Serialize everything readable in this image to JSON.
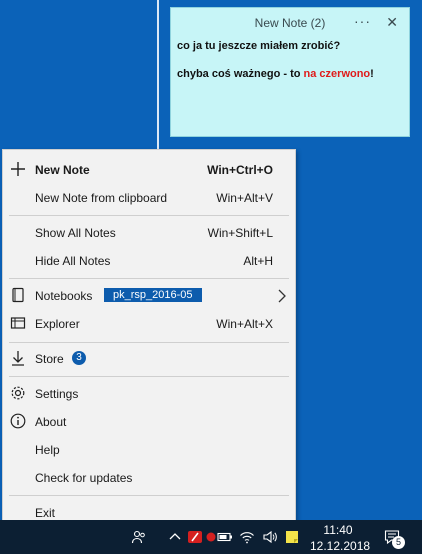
{
  "note": {
    "title": "New Note (2)",
    "more_glyph": "···",
    "close_glyph": "✕",
    "line1": "co ja tu jeszcze miałem zrobić?",
    "line2_prefix": "chyba coś ważnego - to ",
    "line2_red": "na czerwono",
    "line2_suffix": "!"
  },
  "menu": {
    "new_note": {
      "label": "New Note",
      "shortcut": "Win+Ctrl+O"
    },
    "new_from_clipboard": {
      "label": "New Note from clipboard",
      "shortcut": "Win+Alt+V"
    },
    "show_all": {
      "label": "Show All Notes",
      "shortcut": "Win+Shift+L"
    },
    "hide_all": {
      "label": "Hide All Notes",
      "shortcut": "Alt+H"
    },
    "notebooks": {
      "label": "Notebooks",
      "current": "pk_rsp_2016-05"
    },
    "explorer": {
      "label": "Explorer",
      "shortcut": "Win+Alt+X"
    },
    "store": {
      "label": "Store",
      "badge": "3"
    },
    "settings": {
      "label": "Settings"
    },
    "about": {
      "label": "About"
    },
    "help": {
      "label": "Help"
    },
    "check_updates": {
      "label": "Check for updates"
    },
    "exit": {
      "label": "Exit"
    }
  },
  "taskbar": {
    "time": "11:40",
    "date": "12.12.2018",
    "notification_count": "5"
  },
  "colors": {
    "desktop": "#0b62b8",
    "note_bg": "#c7f5f7",
    "accent": "#0d5cad",
    "note_red": "#e01b1b"
  }
}
